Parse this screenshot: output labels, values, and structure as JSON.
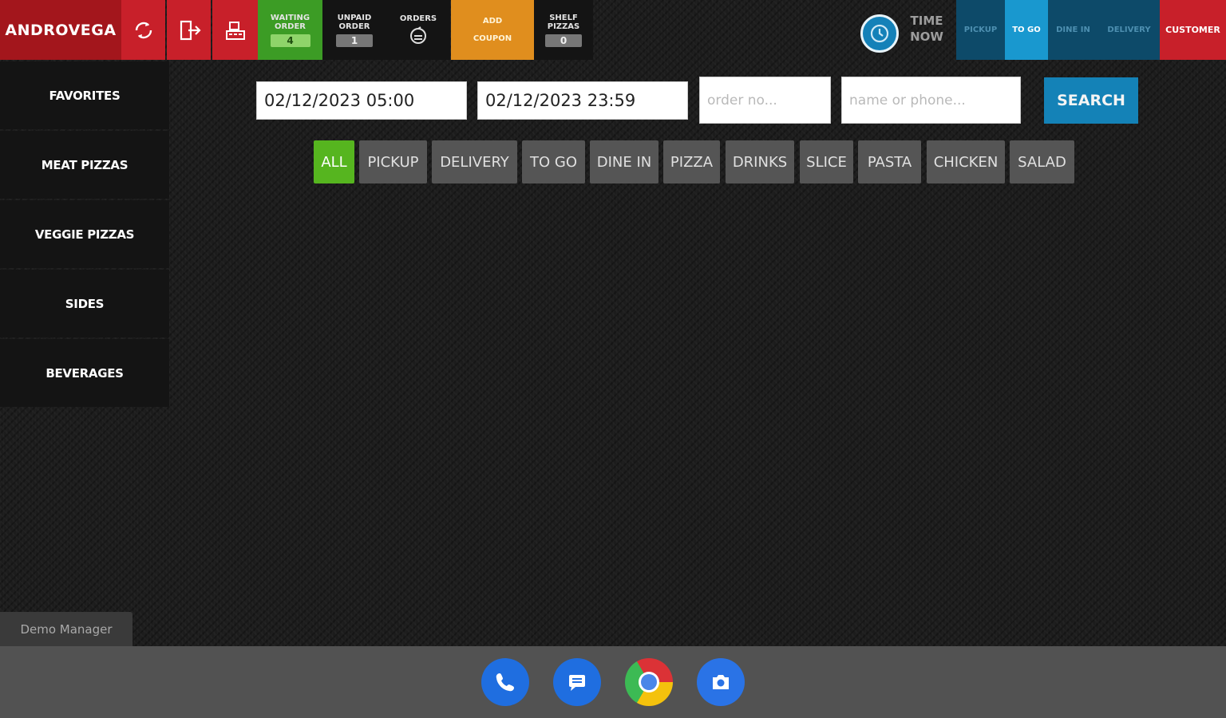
{
  "topbar": {
    "logo": "ANDROVEGA",
    "icons": [
      "refresh-icon",
      "exit-icon",
      "register-icon"
    ],
    "waiting_order": {
      "label": "WAITING ORDER",
      "count": "4"
    },
    "unpaid_order": {
      "label": "UNPAID ORDER",
      "count": "1"
    },
    "orders": {
      "label": "ORDERS"
    },
    "add_coupon": {
      "label": "ADD COUPON"
    },
    "shelf_pizzas": {
      "label": "SHELF PIZZAS",
      "count": "0"
    },
    "time_now": "TIME NOW",
    "order_types": [
      "PICKUP",
      "TO GO",
      "DINE IN",
      "DELIVERY"
    ],
    "active_order_type": "TO GO",
    "customer": "CUSTOMER"
  },
  "sidebar": {
    "items": [
      {
        "label": "FAVORITES"
      },
      {
        "label": "MEAT PIZZAS"
      },
      {
        "label": "VEGGIE PIZZAS"
      },
      {
        "label": "SIDES"
      },
      {
        "label": "BEVERAGES"
      }
    ]
  },
  "search": {
    "date_from": "02/12/2023 05:00",
    "date_to": "02/12/2023 23:59",
    "order_placeholder": "order no...",
    "name_placeholder": "name or phone...",
    "button": "SEARCH"
  },
  "filters": {
    "chips": [
      "ALL",
      "PICKUP",
      "DELIVERY",
      "TO GO",
      "DINE IN",
      "PIZZA",
      "DRINKS",
      "SLICE",
      "PASTA",
      "CHICKEN",
      "SALAD"
    ],
    "active": "ALL"
  },
  "user": {
    "name": "Demo Manager"
  },
  "taskbar": {
    "apps": [
      "phone-icon",
      "messages-icon",
      "chrome-icon",
      "camera-icon"
    ]
  },
  "colors": {
    "brand_red": "#a3161c",
    "accent_blue": "#1998cf",
    "active_green": "#56b51f",
    "coupon_orange": "#e08e1e"
  }
}
